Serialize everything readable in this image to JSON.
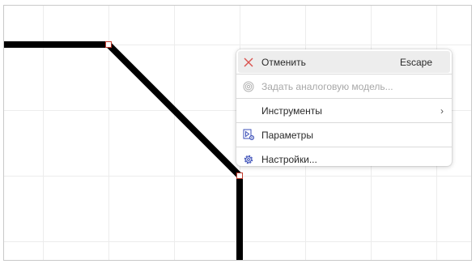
{
  "context_menu": {
    "items": [
      {
        "label": "Отменить",
        "shortcut": "Escape",
        "icon": "close-x-icon",
        "state": "highlighted"
      },
      {
        "label": "Задать аналоговую модель...",
        "icon": "analog-model-icon",
        "state": "disabled"
      },
      {
        "label": "Инструменты",
        "icon": "",
        "submenu": "›",
        "state": "normal"
      },
      {
        "label": "Параметры",
        "icon": "parameters-icon",
        "state": "normal"
      },
      {
        "label": "Настройки...",
        "icon": "gear-icon",
        "state": "normal"
      }
    ]
  },
  "colors": {
    "accent_red": "#d9534f",
    "icon_blue": "#3b4fb8",
    "wire": "#000000",
    "grid": "#ececec"
  }
}
